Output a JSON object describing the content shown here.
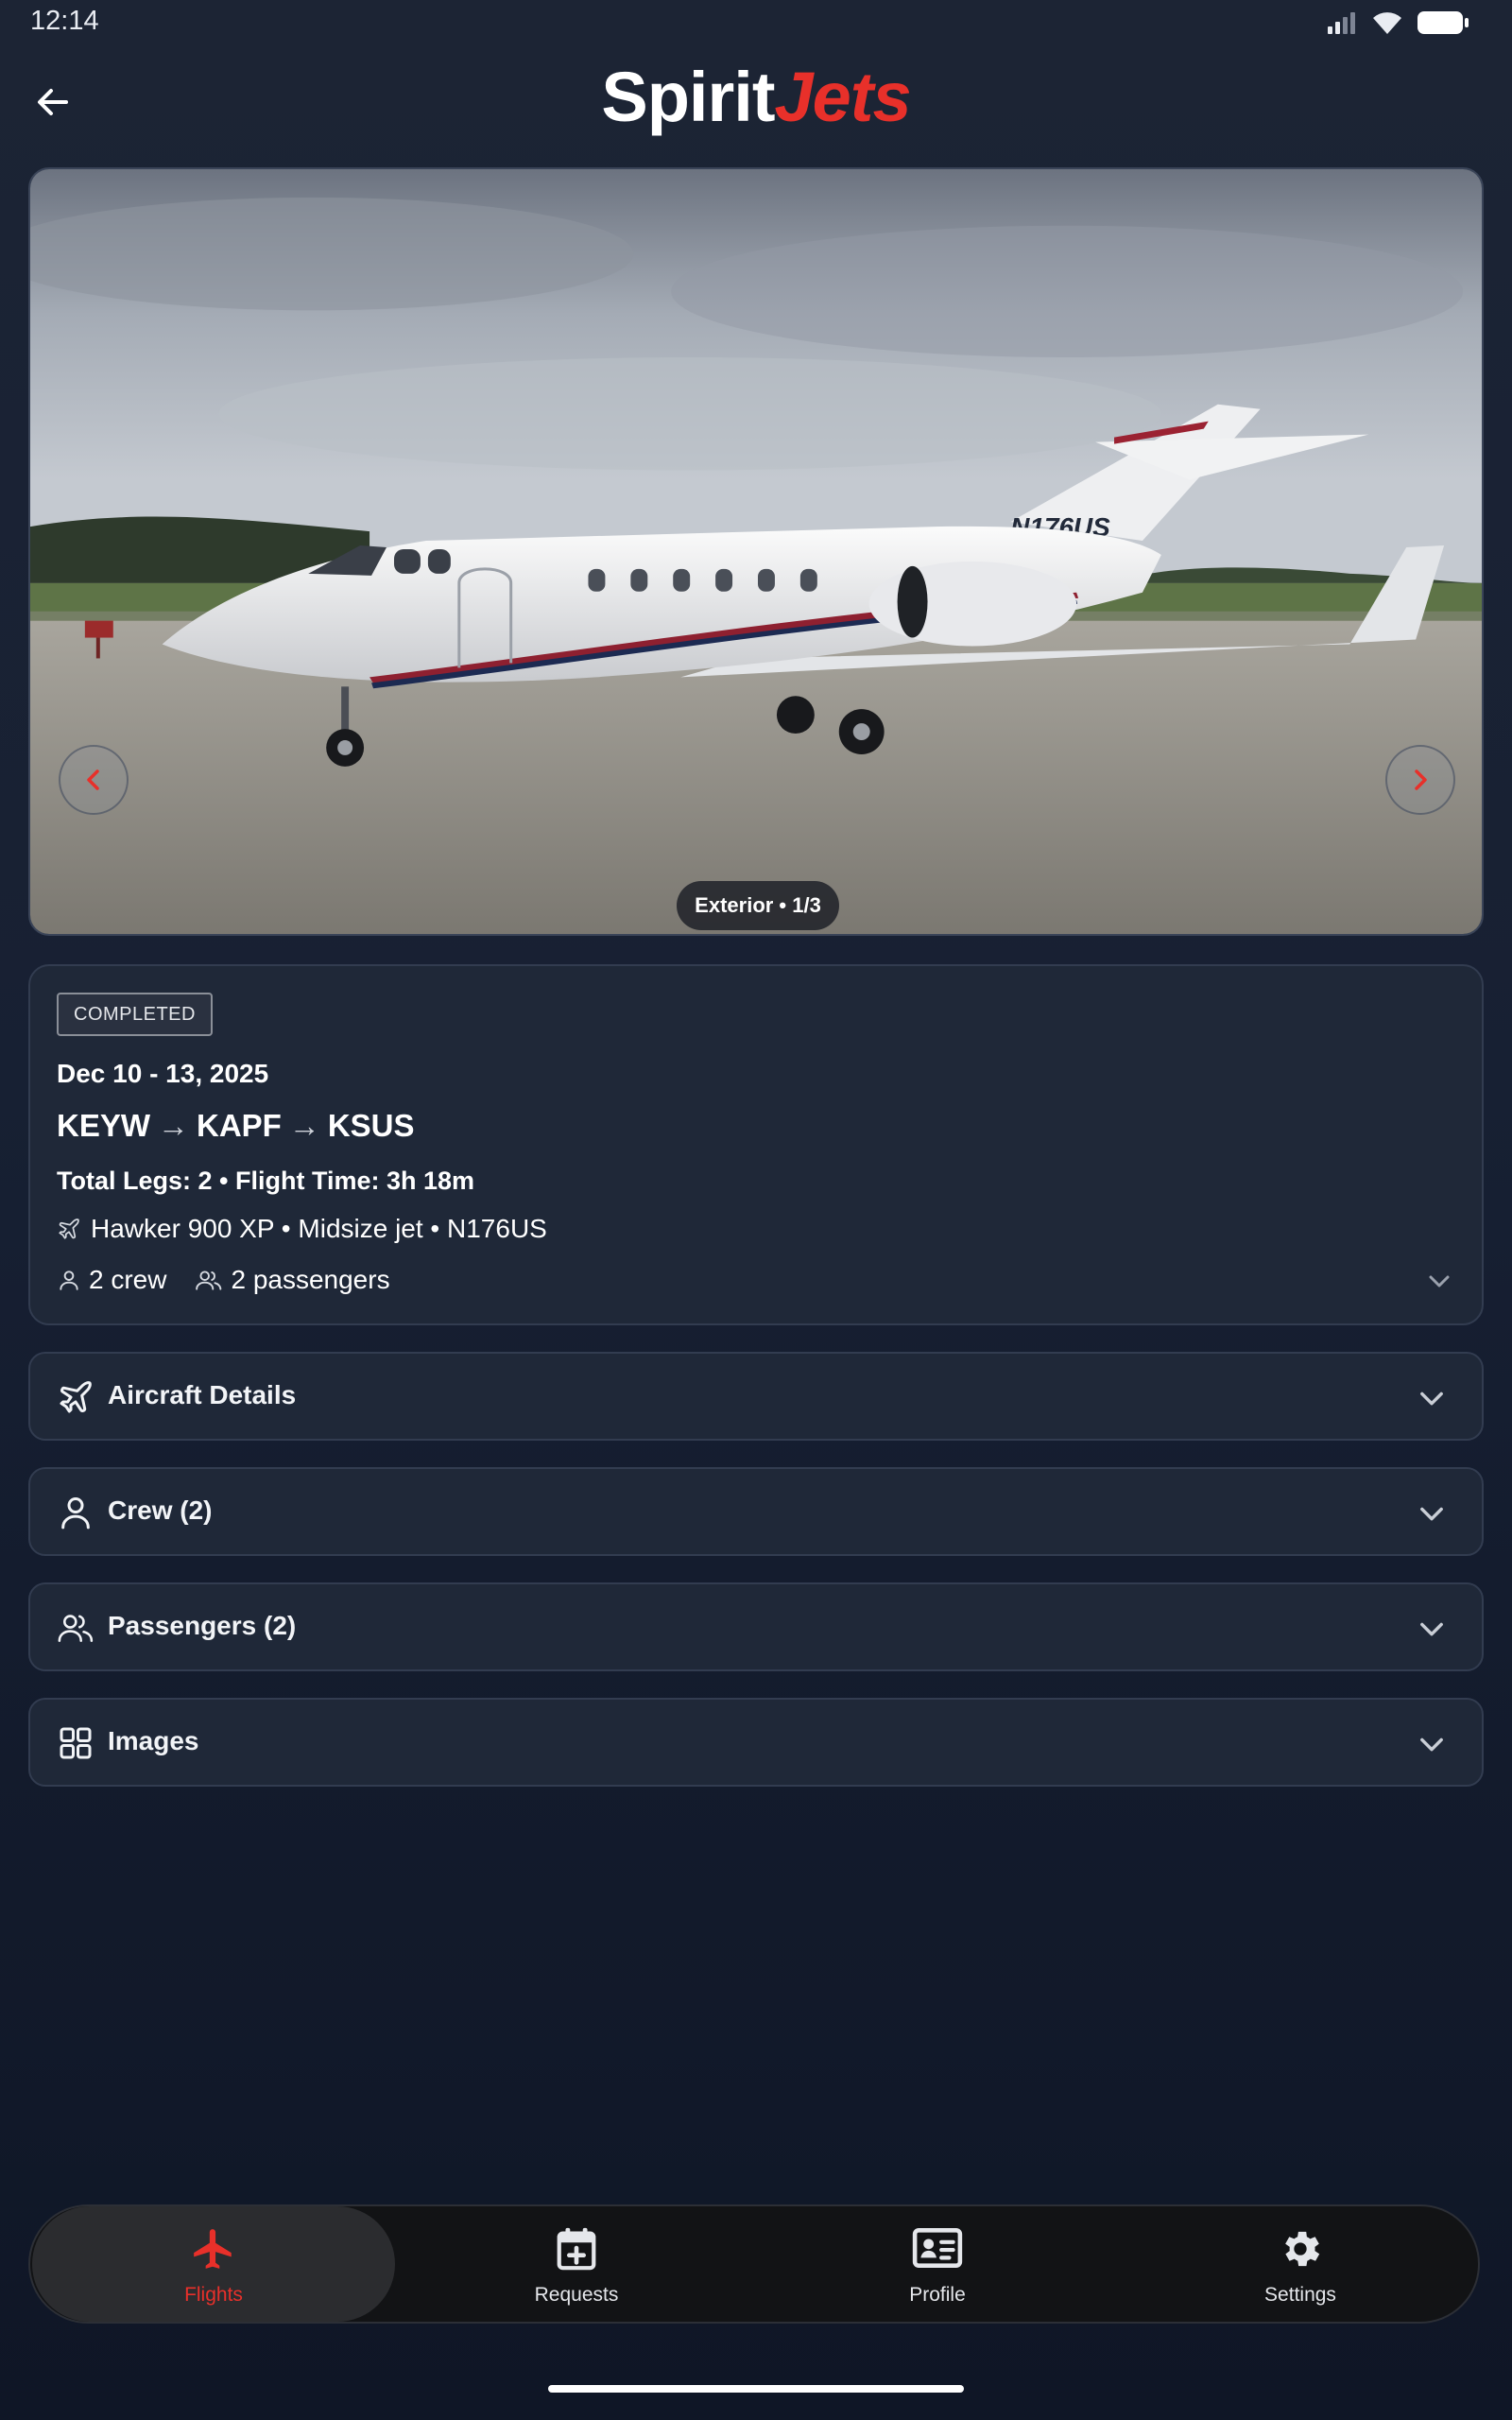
{
  "status_bar": {
    "time": "12:14"
  },
  "header": {
    "logo_part1": "Spirit",
    "logo_part2": "Jets",
    "brand_color": "#e8302a"
  },
  "carousel": {
    "caption": "Exterior • 1/3",
    "tail_number": "N176US"
  },
  "trip": {
    "status": "COMPLETED",
    "dates": "Dec 10 - 13, 2025",
    "route": [
      "KEYW",
      "KAPF",
      "KSUS"
    ],
    "route_arrow": "→",
    "stats": "Total Legs: 2 • Flight Time: 3h 18m",
    "aircraft": "Hawker 900 XP • Midsize jet • N176US",
    "crew": "2 crew",
    "passengers": "2 passengers"
  },
  "sections": [
    {
      "label": "Aircraft Details",
      "icon": "plane-icon"
    },
    {
      "label": "Crew (2)",
      "icon": "person-icon"
    },
    {
      "label": "Passengers (2)",
      "icon": "people-icon"
    },
    {
      "label": "Images",
      "icon": "grid-icon"
    }
  ],
  "nav": [
    {
      "label": "Flights",
      "icon": "airplane-icon",
      "active": true
    },
    {
      "label": "Requests",
      "icon": "calendar-plus-icon",
      "active": false
    },
    {
      "label": "Profile",
      "icon": "id-card-icon",
      "active": false
    },
    {
      "label": "Settings",
      "icon": "gear-icon",
      "active": false
    }
  ]
}
